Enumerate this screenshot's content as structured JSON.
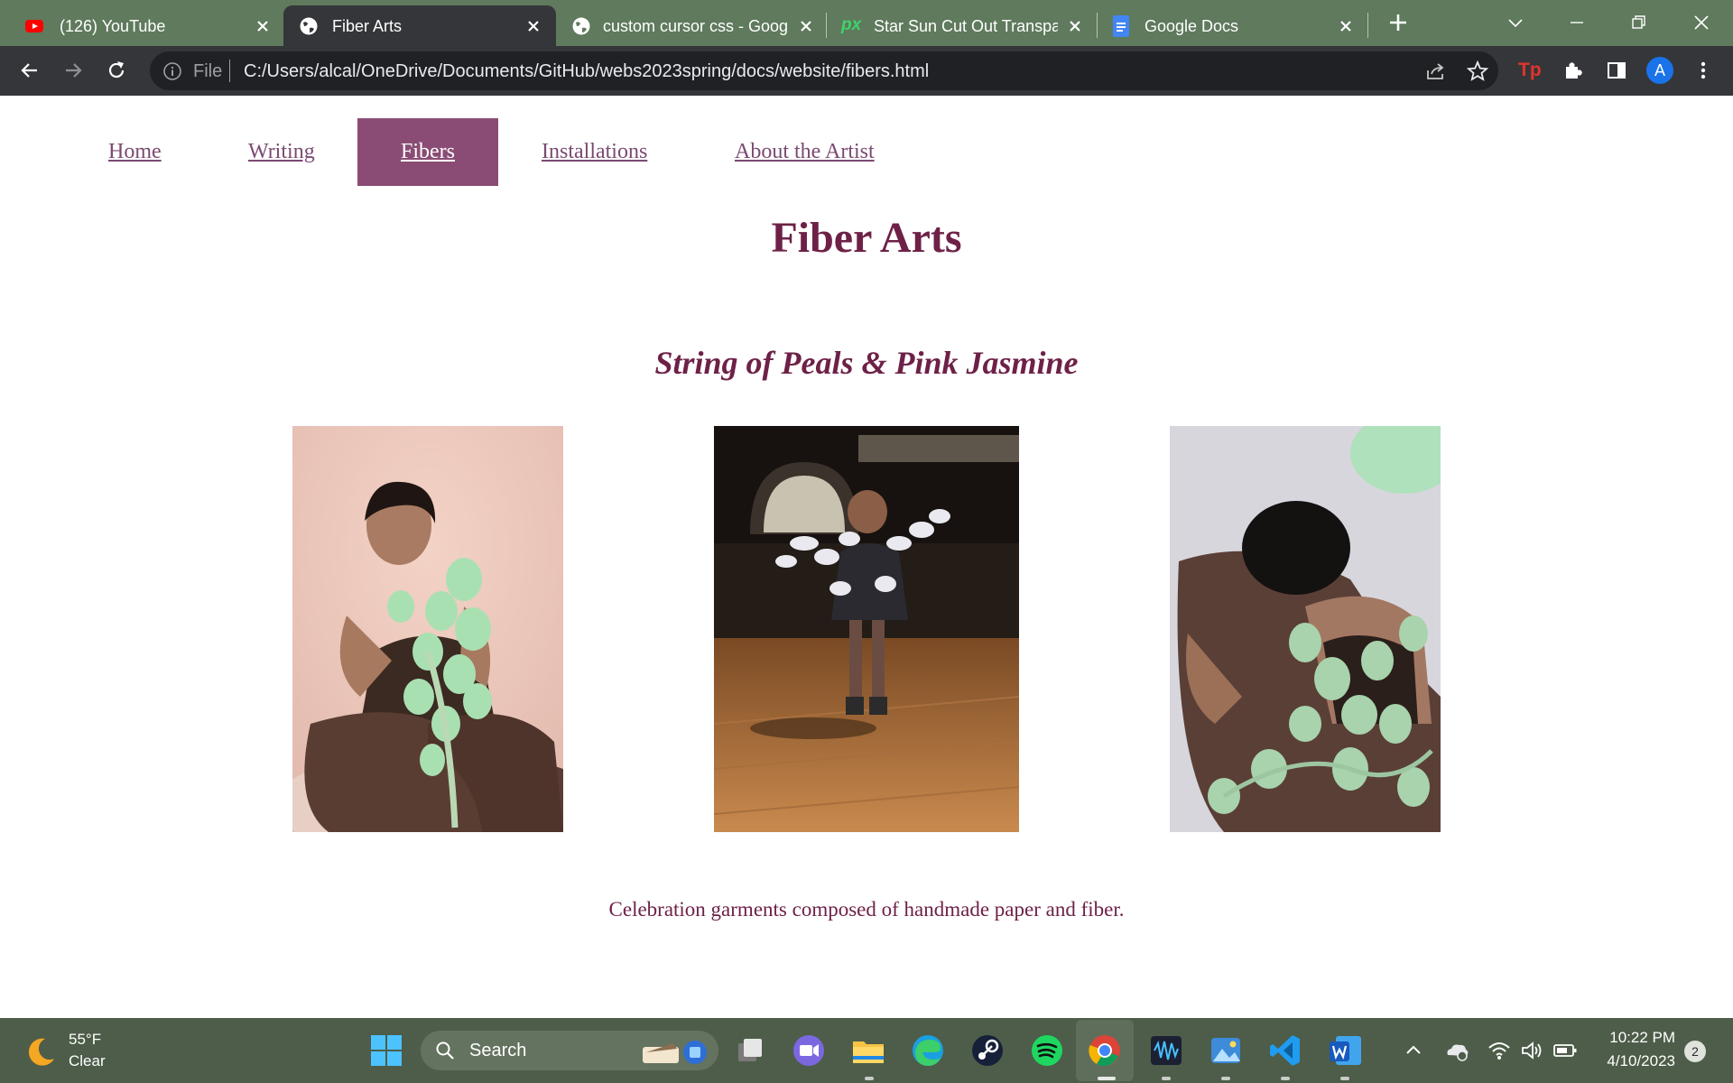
{
  "browser": {
    "tabs": [
      {
        "title": "(126) YouTube",
        "icon": "youtube-icon"
      },
      {
        "title": "Fiber Arts",
        "icon": "globe-icon",
        "active": true
      },
      {
        "title": "custom cursor css - Goog",
        "icon": "globe-icon"
      },
      {
        "title": "Star Sun Cut Out Transpar",
        "icon": "px-icon",
        "icon_text": "px"
      },
      {
        "title": "Google Docs",
        "icon": "docs-icon"
      }
    ],
    "address": {
      "scheme": "File",
      "url": "C:/Users/alcal/OneDrive/Documents/GitHub/webs2023spring/docs/website/fibers.html"
    },
    "profile_initial": "A",
    "extension_badge": "Tp",
    "colors": {
      "tab_strip": "#5f7a5d",
      "toolbar": "#35363a",
      "omnibox": "#202124"
    }
  },
  "site": {
    "nav": [
      {
        "label": "Home"
      },
      {
        "label": "Writing"
      },
      {
        "label": "Fibers",
        "current": true
      },
      {
        "label": "Installations"
      },
      {
        "label": "About the Artist"
      }
    ],
    "page_title": "Fiber Arts",
    "piece_title": "String of Peals & Pink Jasmine",
    "caption": "Celebration garments composed of handmade paper and fiber.",
    "colors": {
      "accent": "#8a4c74",
      "heading": "#6e2147",
      "link": "#7b4a72"
    }
  },
  "taskbar": {
    "weather": {
      "temp": "55°F",
      "condition": "Clear"
    },
    "search_label": "Search",
    "clock": {
      "time": "10:22 PM",
      "date": "4/10/2023"
    },
    "notification_count": "2",
    "apps": [
      "start-icon",
      "search-icon",
      "task-view-icon",
      "teams-icon",
      "file-explorer-icon",
      "edge-icon",
      "steam-icon",
      "spotify-icon",
      "chrome-icon",
      "audio-editor-icon",
      "photos-icon",
      "vscode-icon",
      "word-icon"
    ]
  }
}
